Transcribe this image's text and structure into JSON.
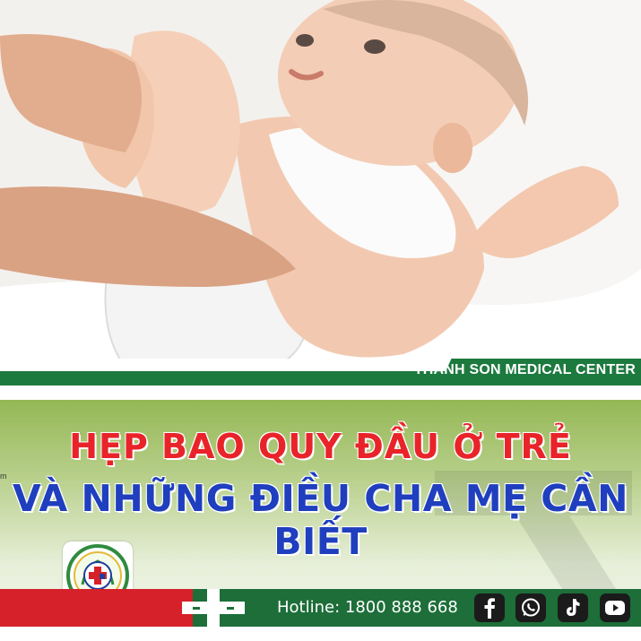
{
  "brand": {
    "name": "THANH SON MEDICAL CENTER"
  },
  "title": {
    "line1": "HẸP BAO QUY ĐẦU Ở TRẺ",
    "line2": "VÀ NHỮNG ĐIỀU CHA MẸ CẦN BIẾT"
  },
  "stray_text": "m",
  "footer": {
    "hotline": "Hotline: 1800 888 668",
    "social": [
      "facebook-icon",
      "whatsapp-icon",
      "tiktok-icon",
      "youtube-icon"
    ]
  },
  "colors": {
    "brand_green": "#1d7a3f",
    "footer_green": "#1d6e39",
    "footer_red": "#d6202a",
    "title_red": "#e8242a",
    "title_blue": "#1f3fbf"
  }
}
